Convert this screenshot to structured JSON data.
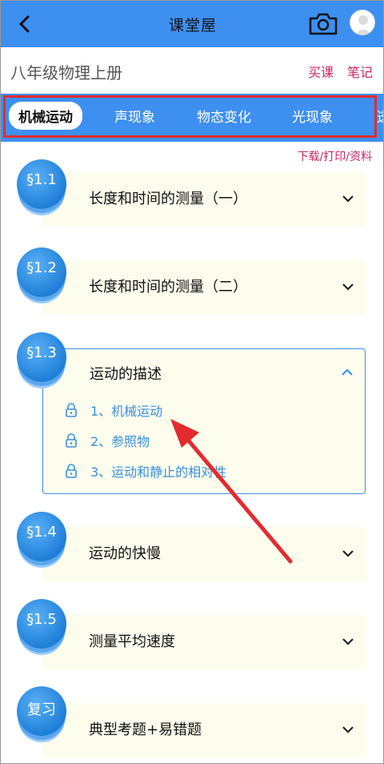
{
  "header": {
    "title": "课堂屋",
    "back_icon": "back-chevron-icon",
    "camera_icon": "camera-icon",
    "avatar_icon": "avatar-icon"
  },
  "book": {
    "title": "八年级物理上册",
    "buy_label": "买课",
    "notes_label": "笔记"
  },
  "tabs": [
    {
      "label": "机械运动",
      "active": true
    },
    {
      "label": "声现象",
      "active": false
    },
    {
      "label": "物态变化",
      "active": false
    },
    {
      "label": "光现象",
      "active": false
    }
  ],
  "download_label": "下载/打印/资料",
  "chapters": [
    {
      "badge": "§1.1",
      "title": "长度和时间的测量（一）",
      "expanded": false
    },
    {
      "badge": "§1.2",
      "title": "长度和时间的测量（二）",
      "expanded": false
    },
    {
      "badge": "§1.3",
      "title": "运动的描述",
      "expanded": true,
      "lessons": [
        {
          "label": "1、机械运动",
          "locked": true
        },
        {
          "label": "2、参照物",
          "locked": true
        },
        {
          "label": "3、运动和静止的相对性",
          "locked": true
        }
      ]
    },
    {
      "badge": "§1.4",
      "title": "运动的快慢",
      "expanded": false
    },
    {
      "badge": "§1.5",
      "title": "测量平均速度",
      "expanded": false
    },
    {
      "badge": "复习",
      "title": "典型考题+易错题",
      "expanded": false
    }
  ],
  "colors": {
    "primary": "#3d8ff0",
    "accent": "#cc2566",
    "annotation": "#e32b30",
    "card_bg": "#fdfdee",
    "lesson_text": "#3a8fdf"
  }
}
